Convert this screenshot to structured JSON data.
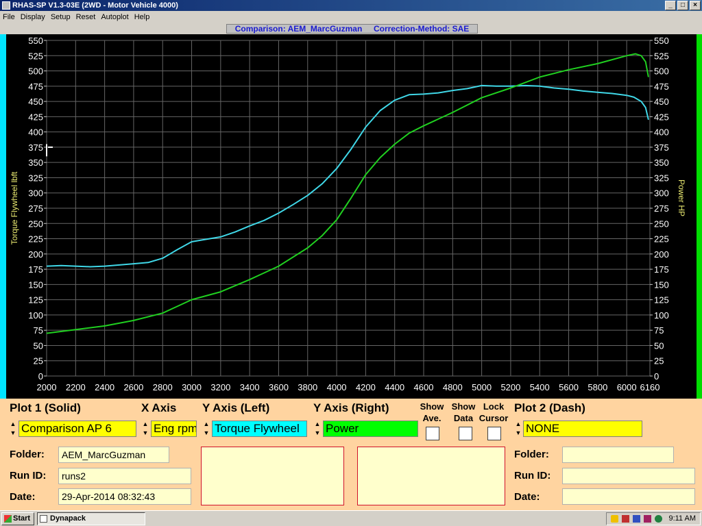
{
  "window": {
    "title": "RHAS-SP V1.3-03E  (2WD - Motor Vehicle 4000)",
    "btn_min": "_",
    "btn_max": "□",
    "btn_close": "×"
  },
  "menu": {
    "items": [
      "File",
      "Display",
      "Setup",
      "Reset",
      "Autoplot",
      "Help"
    ]
  },
  "caption": "Comparison: AEM_MarcGuzman     Correction-Method: SAE",
  "chart_data": {
    "type": "line",
    "xlabel": "",
    "ylabel_left": "Torque Flywheel lbft",
    "ylabel_right": "Power HP",
    "xlim": [
      2000,
      6160
    ],
    "ylim": [
      0,
      550
    ],
    "x_ticks": [
      2000,
      2200,
      2400,
      2600,
      2800,
      3000,
      3200,
      3400,
      3600,
      3800,
      4000,
      4200,
      4400,
      4600,
      4800,
      5000,
      5200,
      5400,
      5600,
      5800,
      6000,
      6160
    ],
    "y_ticks": [
      0,
      25,
      50,
      75,
      100,
      125,
      150,
      175,
      200,
      225,
      250,
      275,
      300,
      325,
      350,
      375,
      400,
      425,
      450,
      475,
      500,
      525,
      550
    ],
    "grid": true,
    "series": [
      {
        "name": "Torque Flywheel lbft",
        "color": "#40d8e8",
        "x": [
          2000,
          2100,
          2200,
          2300,
          2400,
          2500,
          2600,
          2700,
          2800,
          2900,
          3000,
          3100,
          3200,
          3300,
          3400,
          3500,
          3600,
          3700,
          3800,
          3900,
          4000,
          4100,
          4200,
          4300,
          4400,
          4500,
          4600,
          4700,
          4800,
          4900,
          5000,
          5100,
          5200,
          5300,
          5400,
          5500,
          5600,
          5700,
          5800,
          5900,
          6000,
          6050,
          6100,
          6130,
          6150
        ],
        "values": [
          180,
          181,
          180,
          179,
          180,
          182,
          184,
          186,
          193,
          207,
          220,
          224,
          228,
          236,
          246,
          255,
          267,
          281,
          296,
          315,
          340,
          372,
          408,
          435,
          452,
          461,
          462,
          464,
          468,
          471,
          476,
          475,
          475,
          476,
          475,
          472,
          470,
          467,
          465,
          463,
          460,
          457,
          450,
          440,
          420
        ]
      },
      {
        "name": "Power HP",
        "color": "#20d020",
        "x": [
          2000,
          2200,
          2400,
          2600,
          2800,
          3000,
          3200,
          3400,
          3600,
          3800,
          3900,
          4000,
          4100,
          4200,
          4300,
          4400,
          4500,
          4600,
          4800,
          5000,
          5200,
          5400,
          5600,
          5800,
          6000,
          6060,
          6100,
          6130,
          6150
        ],
        "values": [
          70,
          76,
          82,
          91,
          103,
          125,
          138,
          158,
          180,
          210,
          230,
          256,
          292,
          330,
          358,
          380,
          398,
          410,
          432,
          456,
          472,
          490,
          502,
          512,
          525,
          528,
          525,
          515,
          490
        ]
      }
    ]
  },
  "controls": {
    "plot1_label": "Plot 1 (Solid)",
    "xaxis_label": "X Axis",
    "yleft_label": "Y Axis (Left)",
    "yright_label": "Y Axis (Right)",
    "show_ave": "Show\nAve.",
    "show_data": "Show\nData",
    "lock_cursor": "Lock\nCursor",
    "plot2_label": "Plot 2 (Dash)",
    "plot1_value": "Comparison AP 6",
    "xaxis_value": "Eng rpm",
    "yleft_value": "Torque Flywheel",
    "yright_value": "Power",
    "plot2_value": "NONE",
    "folder_label": "Folder:",
    "runid_label": "Run ID:",
    "date_label": "Date:",
    "folder_value": "AEM_MarcGuzman",
    "runid_value": "runs2",
    "date_value": "29-Apr-2014  08:32:43",
    "folder2_label": "Folder:",
    "runid2_label": "Run ID:",
    "date2_label": "Date:",
    "folder2_value": "",
    "runid2_value": "",
    "date2_value": "",
    "spin_up": "▲",
    "spin_down": "▼"
  },
  "taskbar": {
    "start": "Start",
    "task": "Dynapack",
    "clock": "9:11 AM"
  }
}
